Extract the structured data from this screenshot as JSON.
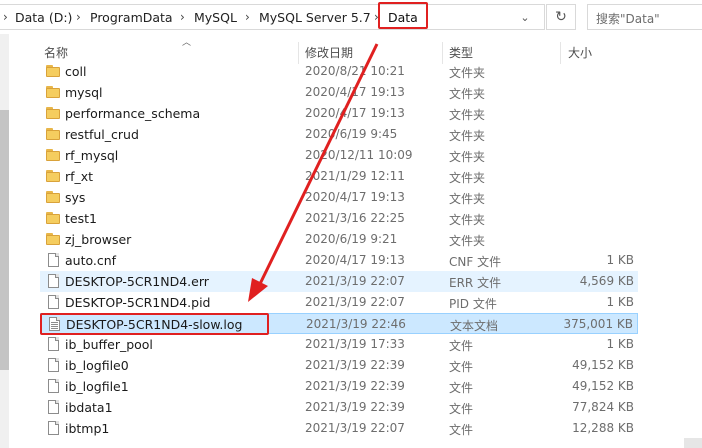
{
  "breadcrumb": {
    "items": [
      "Data (D:)",
      "ProgramData",
      "MySQL",
      "MySQL Server 5.7",
      "Data"
    ]
  },
  "search": {
    "placeholder": "搜索\"Data\""
  },
  "columns": {
    "name": "名称",
    "date": "修改日期",
    "type": "类型",
    "size": "大小"
  },
  "files": [
    {
      "name": "coll",
      "date": "2020/8/21 10:21",
      "type": "文件夹",
      "size": "",
      "kind": "folder"
    },
    {
      "name": "mysql",
      "date": "2020/4/17 19:13",
      "type": "文件夹",
      "size": "",
      "kind": "folder"
    },
    {
      "name": "performance_schema",
      "date": "2020/4/17 19:13",
      "type": "文件夹",
      "size": "",
      "kind": "folder"
    },
    {
      "name": "restful_crud",
      "date": "2020/6/19 9:45",
      "type": "文件夹",
      "size": "",
      "kind": "folder"
    },
    {
      "name": "rf_mysql",
      "date": "2020/12/11 10:09",
      "type": "文件夹",
      "size": "",
      "kind": "folder"
    },
    {
      "name": "rf_xt",
      "date": "2021/1/29 12:11",
      "type": "文件夹",
      "size": "",
      "kind": "folder"
    },
    {
      "name": "sys",
      "date": "2020/4/17 19:13",
      "type": "文件夹",
      "size": "",
      "kind": "folder"
    },
    {
      "name": "test1",
      "date": "2021/3/16 22:25",
      "type": "文件夹",
      "size": "",
      "kind": "folder"
    },
    {
      "name": "zj_browser",
      "date": "2020/6/19 9:21",
      "type": "文件夹",
      "size": "",
      "kind": "folder"
    },
    {
      "name": "auto.cnf",
      "date": "2020/4/17 19:13",
      "type": "CNF 文件",
      "size": "1 KB",
      "kind": "file"
    },
    {
      "name": "DESKTOP-5CR1ND4.err",
      "date": "2021/3/19 22:07",
      "type": "ERR 文件",
      "size": "4,569 KB",
      "kind": "file",
      "state": "hover"
    },
    {
      "name": "DESKTOP-5CR1ND4.pid",
      "date": "2021/3/19 22:07",
      "type": "PID 文件",
      "size": "1 KB",
      "kind": "file"
    },
    {
      "name": "DESKTOP-5CR1ND4-slow.log",
      "date": "2021/3/19 22:46",
      "type": "文本文档",
      "size": "375,001 KB",
      "kind": "text",
      "state": "selected"
    },
    {
      "name": "ib_buffer_pool",
      "date": "2021/3/19 17:33",
      "type": "文件",
      "size": "1 KB",
      "kind": "file"
    },
    {
      "name": "ib_logfile0",
      "date": "2021/3/19 22:39",
      "type": "文件",
      "size": "49,152 KB",
      "kind": "file"
    },
    {
      "name": "ib_logfile1",
      "date": "2021/3/19 22:39",
      "type": "文件",
      "size": "49,152 KB",
      "kind": "file"
    },
    {
      "name": "ibdata1",
      "date": "2021/3/19 22:39",
      "type": "文件",
      "size": "77,824 KB",
      "kind": "file"
    },
    {
      "name": "ibtmp1",
      "date": "2021/3/19 22:07",
      "type": "文件",
      "size": "12,288 KB",
      "kind": "file"
    }
  ],
  "colors": {
    "annotation": "#e02020",
    "selected": "#cce8ff",
    "folder": "#f5cd5f"
  }
}
